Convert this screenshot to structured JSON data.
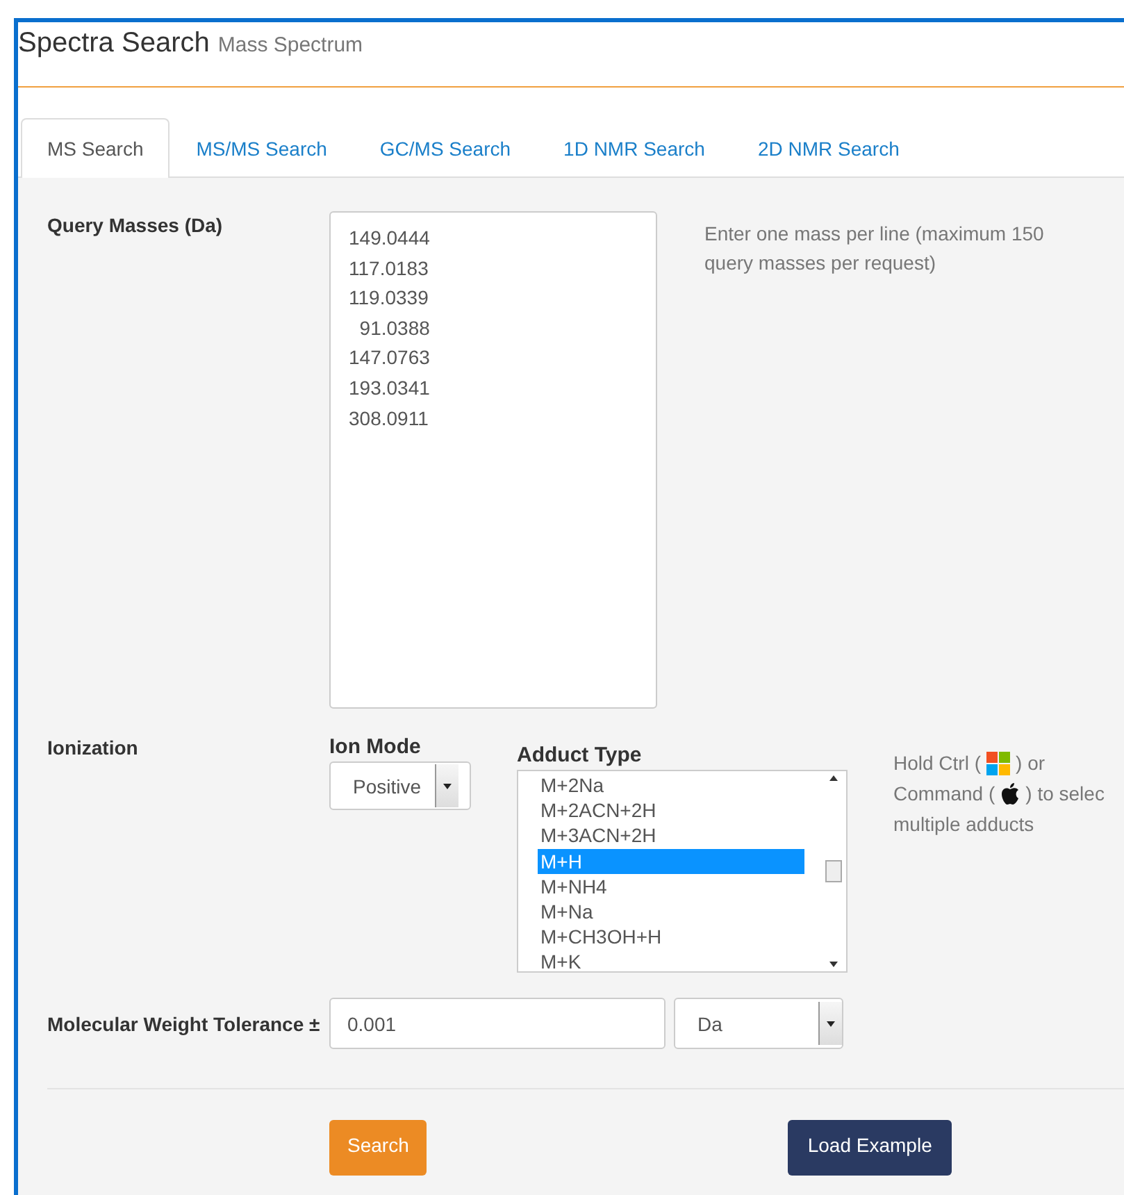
{
  "header": {
    "title": "Spectra Search",
    "subtitle": "Mass Spectrum"
  },
  "tabs": [
    {
      "label": "MS Search",
      "selected": true
    },
    {
      "label": "MS/MS Search",
      "selected": false
    },
    {
      "label": "GC/MS Search",
      "selected": false
    },
    {
      "label": "1D NMR Search",
      "selected": false
    },
    {
      "label": "2D NMR Search",
      "selected": false
    }
  ],
  "query_masses": {
    "label": "Query Masses (Da)",
    "value": "149.0444\n117.0183\n119.0339\n  91.0388\n147.0763\n193.0341\n308.0911",
    "help": "Enter one mass per line (maximum 150 query masses per request)"
  },
  "ionization": {
    "label": "Ionization",
    "ion_mode": {
      "label": "Ion Mode",
      "value": "Positive"
    },
    "adduct_type": {
      "label": "Adduct Type",
      "options": [
        {
          "label": "M+2Na",
          "selected": false
        },
        {
          "label": "M+2ACN+2H",
          "selected": false
        },
        {
          "label": "M+3ACN+2H",
          "selected": false
        },
        {
          "label": "M+H",
          "selected": true
        },
        {
          "label": "M+NH4",
          "selected": false
        },
        {
          "label": "M+Na",
          "selected": false
        },
        {
          "label": "M+CH3OH+H",
          "selected": false
        },
        {
          "label": "M+K",
          "selected": false
        }
      ]
    },
    "help": [
      [
        {
          "kind": "text",
          "text": "Hold Ctrl ("
        },
        {
          "kind": "windows"
        },
        {
          "kind": "text",
          "text": ") or"
        }
      ],
      [
        {
          "kind": "text",
          "text": "Command ("
        },
        {
          "kind": "apple"
        },
        {
          "kind": "text",
          "text": ") to selec"
        }
      ],
      [
        {
          "kind": "text",
          "text": "multiple adducts"
        }
      ]
    ]
  },
  "tolerance": {
    "label": "Molecular Weight Tolerance ±",
    "value": "0.001",
    "unit": "Da"
  },
  "buttons": [
    {
      "label": "Search",
      "kind": "primary"
    },
    {
      "label": "Load Example",
      "kind": "secondary"
    }
  ]
}
